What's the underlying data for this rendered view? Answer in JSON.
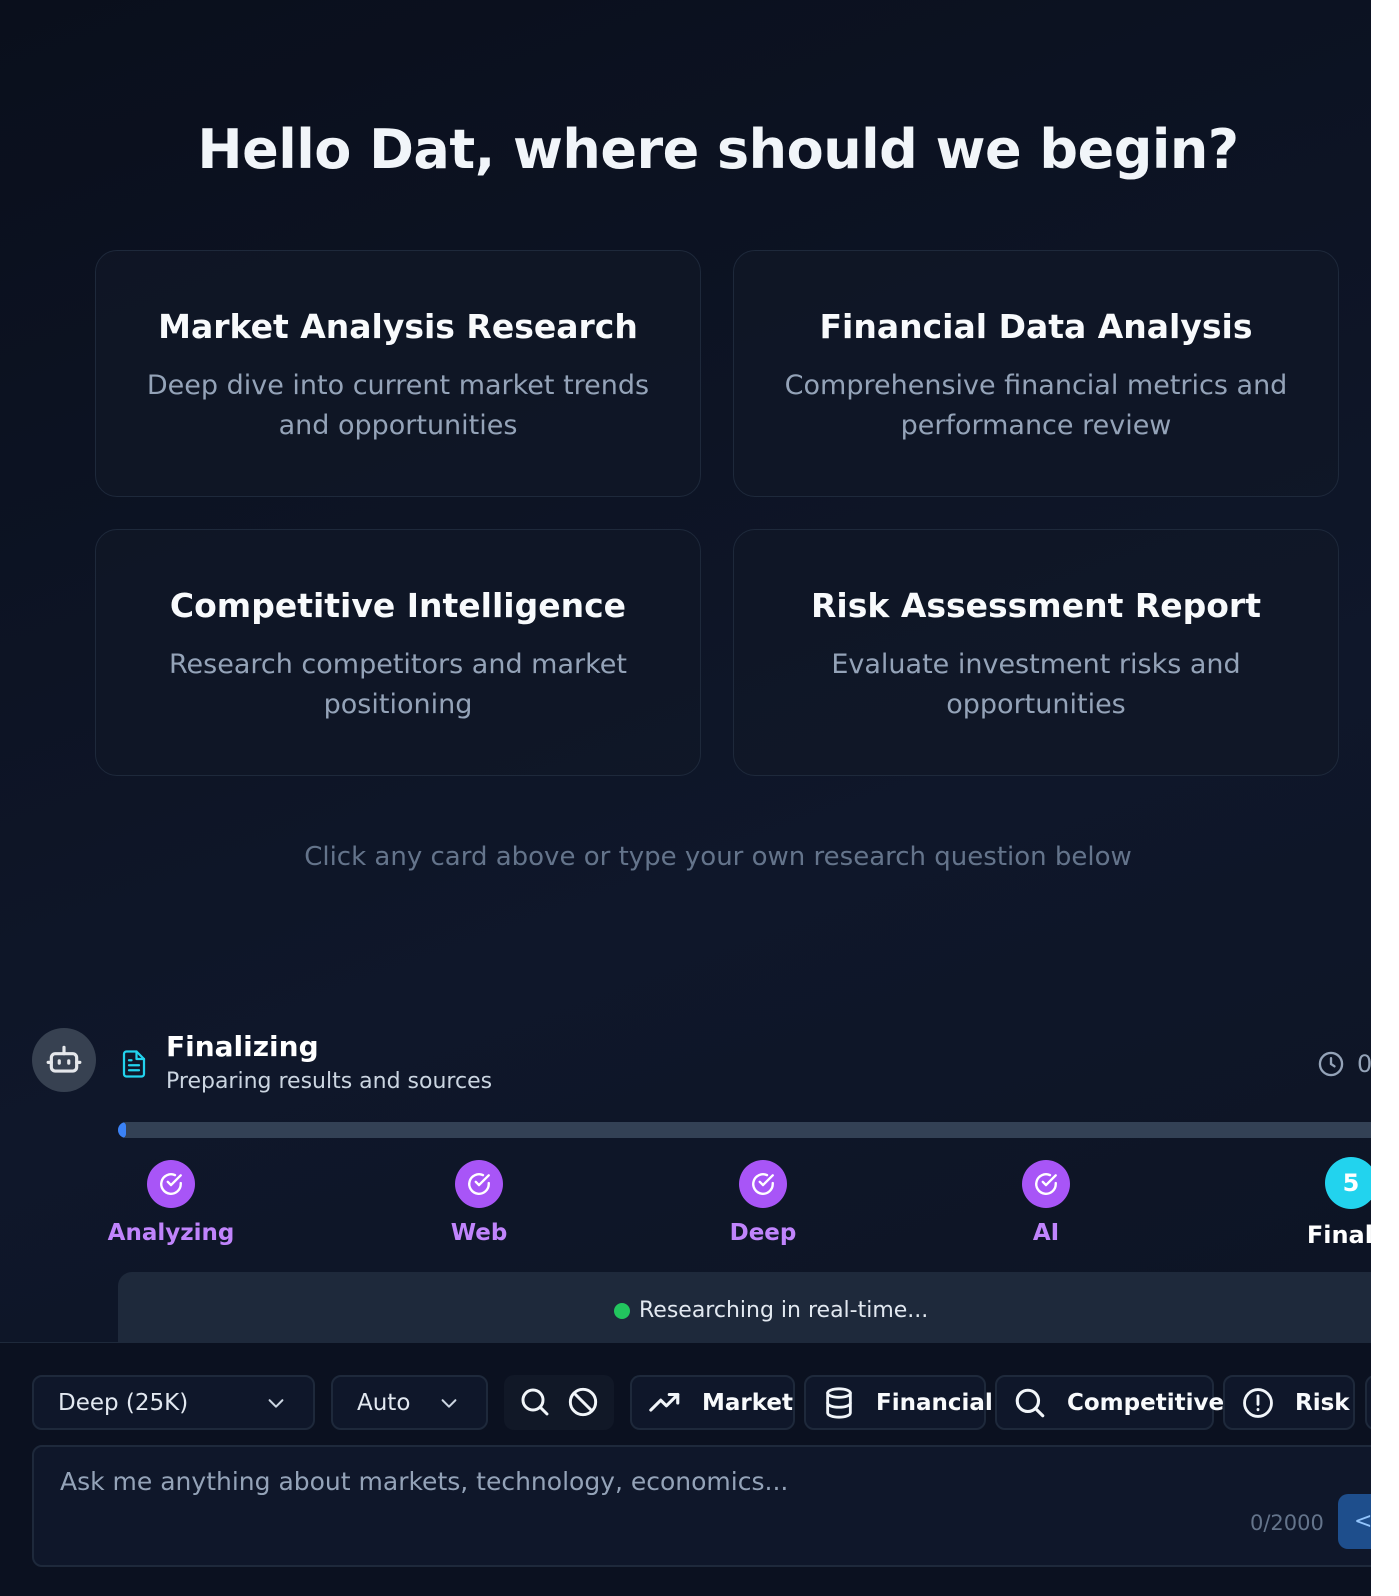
{
  "greeting": "Hello Dat, where should we begin?",
  "cards": [
    {
      "title": "Market Analysis Research",
      "description": "Deep dive into current market trends and opportunities"
    },
    {
      "title": "Financial Data Analysis",
      "description": "Comprehensive financial metrics and performance review"
    },
    {
      "title": "Competitive Intelligence",
      "description": "Research competitors and market positioning"
    },
    {
      "title": "Risk Assessment Report",
      "description": "Evaluate investment risks and opportunities"
    }
  ],
  "hint": "Click any card above or type your own research question below",
  "status": {
    "avatar_icon": "robot-icon",
    "stage_icon": "document-icon",
    "title": "Finalizing",
    "subtitle": "Preparing results and sources",
    "elapsed": "0",
    "progress": 0.005
  },
  "steps": [
    {
      "label": "Analyzing",
      "state": "done"
    },
    {
      "label": "Web",
      "state": "done"
    },
    {
      "label": "Deep",
      "state": "done"
    },
    {
      "label": "AI",
      "state": "done"
    },
    {
      "label": "Finaliz",
      "state": "active",
      "number": "5"
    }
  ],
  "live_status": "Researching in real-time...",
  "controls": {
    "depth": "Deep (25K)",
    "mode": "Auto",
    "search_toggle_icons": [
      "search-icon",
      "no-search-icon"
    ],
    "chips": [
      {
        "label": "Market",
        "icon": "trending-up-icon"
      },
      {
        "label": "Financial",
        "icon": "database-icon"
      },
      {
        "label": "Competitive",
        "icon": "search-icon"
      },
      {
        "label": "Risk",
        "icon": "alert-circle-icon"
      }
    ]
  },
  "input": {
    "placeholder": "Ask me anything about markets, technology, economics...",
    "char_count": "0/2000",
    "send_glyph": "<"
  },
  "colors": {
    "background": "#0f172a",
    "step_done": "#a855f7",
    "step_active": "#22d3ee",
    "progress_fill": "#3b82f6",
    "live_dot": "#22c55e"
  }
}
